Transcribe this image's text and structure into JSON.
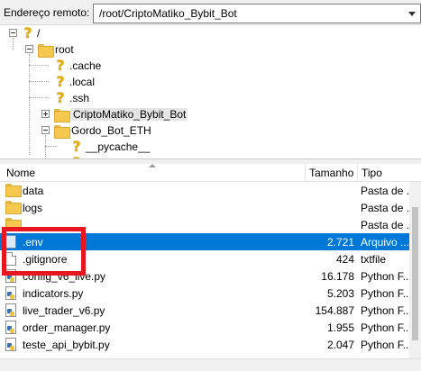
{
  "address": {
    "label": "Endereço remoto:",
    "value": "/root/CriptoMatiko_Bybit_Bot"
  },
  "tree": {
    "items": [
      {
        "label": "/",
        "icon": "question-icon"
      },
      {
        "label": "root",
        "icon": "folder-icon"
      },
      {
        "label": ".cache",
        "icon": "question-icon"
      },
      {
        "label": ".local",
        "icon": "question-icon"
      },
      {
        "label": ".ssh",
        "icon": "question-icon"
      },
      {
        "label": "CriptoMatiko_Bybit_Bot",
        "icon": "folder-icon"
      },
      {
        "label": "Gordo_Bot_ETH",
        "icon": "folder-icon"
      },
      {
        "label": "__pycache__",
        "icon": "question-icon"
      }
    ]
  },
  "list": {
    "headers": {
      "name": "Nome",
      "size": "Tamanho",
      "type": "Tipo"
    },
    "rows": [
      {
        "name": "data",
        "size": "",
        "type": "Pasta de ...",
        "icon": "folder-icon"
      },
      {
        "name": "logs",
        "size": "",
        "type": "Pasta de ...",
        "icon": "folder-icon"
      },
      {
        "name": "",
        "size": "",
        "type": "Pasta de ...",
        "icon": "folder-icon"
      },
      {
        "name": ".env",
        "size": "2.721",
        "type": "Arquivo ...",
        "icon": "env-file-icon"
      },
      {
        "name": ".gitignore",
        "size": "424",
        "type": "txtfile",
        "icon": "file-icon"
      },
      {
        "name": "config_v6_live.py",
        "size": "16.178",
        "type": "Python F...",
        "icon": "python-file-icon"
      },
      {
        "name": "indicators.py",
        "size": "5.203",
        "type": "Python F...",
        "icon": "python-file-icon"
      },
      {
        "name": "live_trader_v6.py",
        "size": "154.887",
        "type": "Python F...",
        "icon": "python-file-icon"
      },
      {
        "name": "order_manager.py",
        "size": "1.955",
        "type": "Python F...",
        "icon": "python-file-icon"
      },
      {
        "name": "teste_api_bybit.py",
        "size": "2.047",
        "type": "Python F...",
        "icon": "python-file-icon"
      }
    ]
  },
  "colors": {
    "selection": "#0078d7",
    "highlight_box": "#e8161e",
    "folder": "#f5c94e"
  }
}
